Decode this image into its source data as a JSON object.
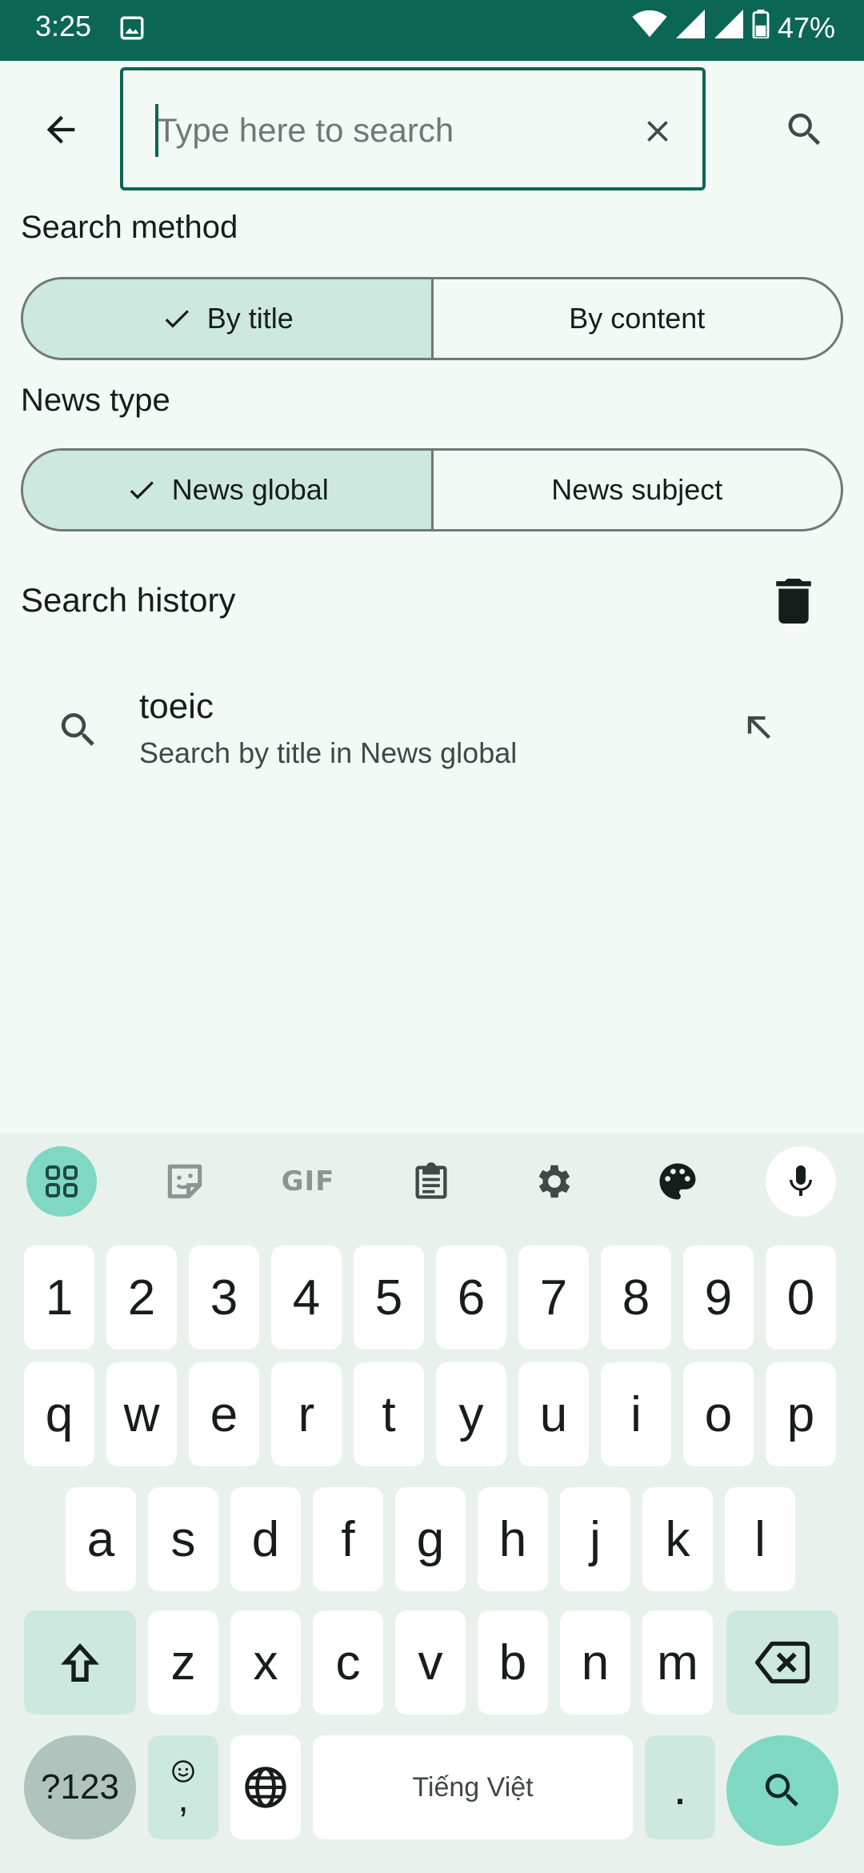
{
  "status_bar": {
    "time": "3:25",
    "battery": "47%",
    "icons": [
      "image-icon",
      "wifi-icon",
      "signal-icon",
      "battery-icon"
    ]
  },
  "search": {
    "placeholder": "Type here to search",
    "value": ""
  },
  "search_method": {
    "label": "Search method",
    "options": [
      "By title",
      "By content"
    ],
    "selected": "By title"
  },
  "news_type": {
    "label": "News type",
    "options": [
      "News global",
      "News subject"
    ],
    "selected": "News global"
  },
  "history": {
    "title": "Search history",
    "items": [
      {
        "query": "toeic",
        "subtitle": "Search by title in News global"
      }
    ]
  },
  "keyboard": {
    "toolbar": [
      "apps-icon",
      "sticker-icon",
      "GIF",
      "clipboard-icon",
      "settings-icon",
      "palette-icon",
      "mic-icon"
    ],
    "gif_label": "GIF",
    "row_numbers": [
      "1",
      "2",
      "3",
      "4",
      "5",
      "6",
      "7",
      "8",
      "9",
      "0"
    ],
    "row1": [
      "q",
      "w",
      "e",
      "r",
      "t",
      "y",
      "u",
      "i",
      "o",
      "p"
    ],
    "row2": [
      "a",
      "s",
      "d",
      "f",
      "g",
      "h",
      "j",
      "k",
      "l"
    ],
    "row3": [
      "z",
      "x",
      "c",
      "v",
      "b",
      "n",
      "m"
    ],
    "symbols_label": "?123",
    "emoji_comma_label": ",",
    "space_label": "Tiếng Việt",
    "period_label": "."
  },
  "colors": {
    "primary": "#0b6654",
    "selected_segment": "#cde8de",
    "background": "#f3faf6",
    "keyboard_accent": "#7fd8c1"
  }
}
